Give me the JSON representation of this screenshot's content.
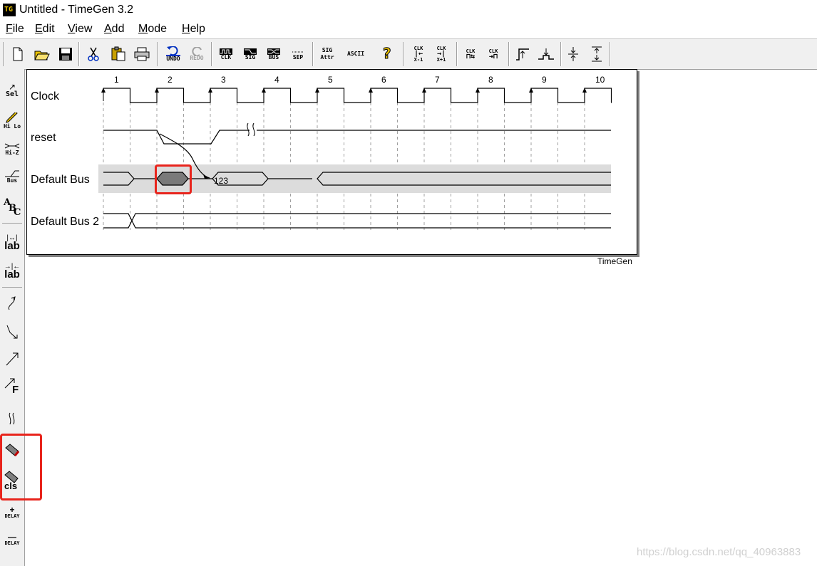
{
  "window": {
    "title": "Untitled - TimeGen 3.2",
    "icon_label": "TG"
  },
  "menu": [
    {
      "label": "File",
      "key": "F",
      "rest": "ile"
    },
    {
      "label": "Edit",
      "key": "E",
      "rest": "dit"
    },
    {
      "label": "View",
      "key": "V",
      "rest": "iew"
    },
    {
      "label": "Add",
      "key": "A",
      "rest": "dd"
    },
    {
      "label": "Mode",
      "key": "M",
      "rest": "ode"
    },
    {
      "label": "Help",
      "key": "H",
      "rest": "elp"
    }
  ],
  "toolbar": {
    "undo": "UNDO",
    "redo": "REDO",
    "clk": "CLK",
    "sig": "SIG",
    "bus": "BUS",
    "sep": "SEP",
    "sig_attr_1": "SIG",
    "sig_attr_2": "Attr",
    "ascii": "ASCII",
    "clk_xm1_top": "CLK",
    "clk_xm1_bot": "X-1",
    "clk_xp1_top": "CLK",
    "clk_xp1_bot": "X+1",
    "clk_a": "CLK",
    "clk_b": "CLK"
  },
  "lefttools": {
    "sel": "Sel",
    "hilo": "Hi Lo",
    "hiz": "Hi-Z",
    "bus": "Bus",
    "abc_a": "A",
    "abc_b": "B",
    "abc_c": "C",
    "lab1": "lab",
    "lab2": "lab",
    "f": "F",
    "cls": "cls",
    "delay_plus": "+",
    "delay_plus_label": "DELAY",
    "delay_minus": "—",
    "delay_minus_label": "DELAY"
  },
  "diagram": {
    "clock_numbers": [
      "1",
      "2",
      "3",
      "4",
      "5",
      "6",
      "7",
      "8",
      "9",
      "10"
    ],
    "signals": [
      {
        "name": "Clock"
      },
      {
        "name": "reset"
      },
      {
        "name": "Default Bus",
        "value": "123"
      },
      {
        "name": "Default Bus 2"
      }
    ],
    "footer": "TimeGen"
  },
  "watermark": "https://blog.csdn.net/qq_40963883",
  "colors": {
    "highlight": "#e8241c",
    "bus_fill": "#7a7a7a",
    "bus_band": "#dcdcdc"
  }
}
